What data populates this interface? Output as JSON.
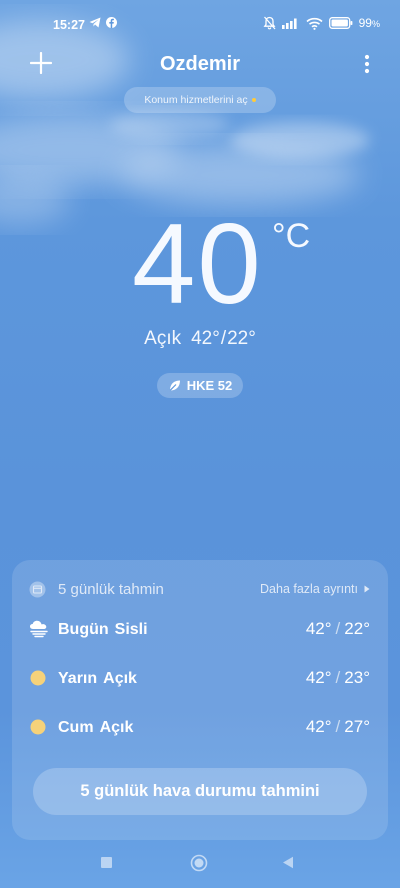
{
  "status_bar": {
    "time": "15:27",
    "battery_pct": "99",
    "left_icons": [
      "telegram-icon",
      "facebook-icon"
    ],
    "right_icons": [
      "muted-bell-icon",
      "signal-icon",
      "wifi-icon",
      "battery-icon"
    ]
  },
  "header": {
    "city": "Ozdemir",
    "location_prompt": "Konum hizmetlerini aç"
  },
  "current": {
    "temperature": "40",
    "unit": "°C",
    "condition": "Açık",
    "high": "42°",
    "low": "22°",
    "separator": "/",
    "aqi_label": "HKE 52"
  },
  "forecast": {
    "title": "5 günlük tahmin",
    "more_link": "Daha fazla ayrıntı",
    "days": [
      {
        "day": "Bugün",
        "condition": "Sisli",
        "high": "42°",
        "low": "22°",
        "icon": "fog-icon"
      },
      {
        "day": "Yarın",
        "condition": "Açık",
        "high": "42°",
        "low": "23°",
        "icon": "sun-icon"
      },
      {
        "day": "Cum",
        "condition": "Açık",
        "high": "42°",
        "low": "27°",
        "icon": "sun-icon"
      }
    ],
    "button_label": "5 günlük hava durumu tahmini"
  },
  "colors": {
    "sky_top": "#6fa5e2",
    "sky_mid": "#5a93da",
    "sun": "#f6d27a",
    "location_dot": "#ffcb3b"
  }
}
